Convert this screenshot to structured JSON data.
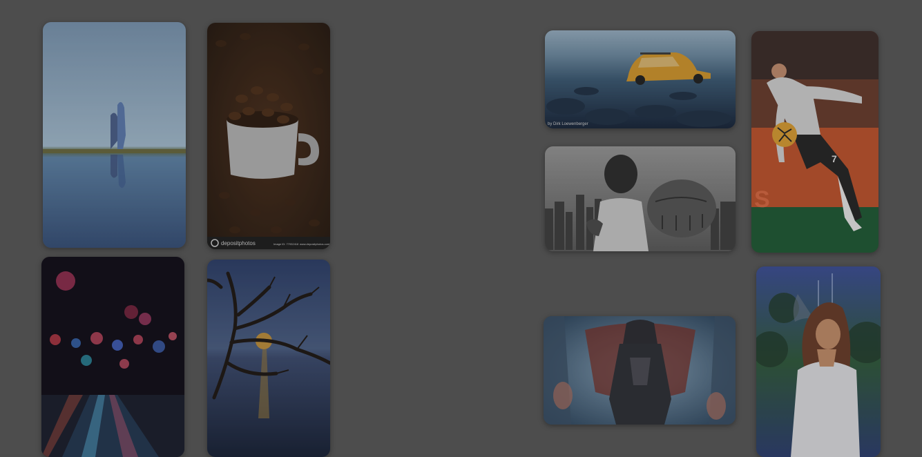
{
  "gallery": {
    "coffee_card": {
      "watermark_brand": "depositphotos",
      "watermark_meta": "Image ID: 77932418",
      "watermark_site": "www.depositphotos.com"
    },
    "beetle_card": {
      "photographer_credit": "by Dirk Loewenberger"
    }
  },
  "colors": {
    "backdrop": "#4d4d4d",
    "soccer_jersey_number": "7"
  }
}
